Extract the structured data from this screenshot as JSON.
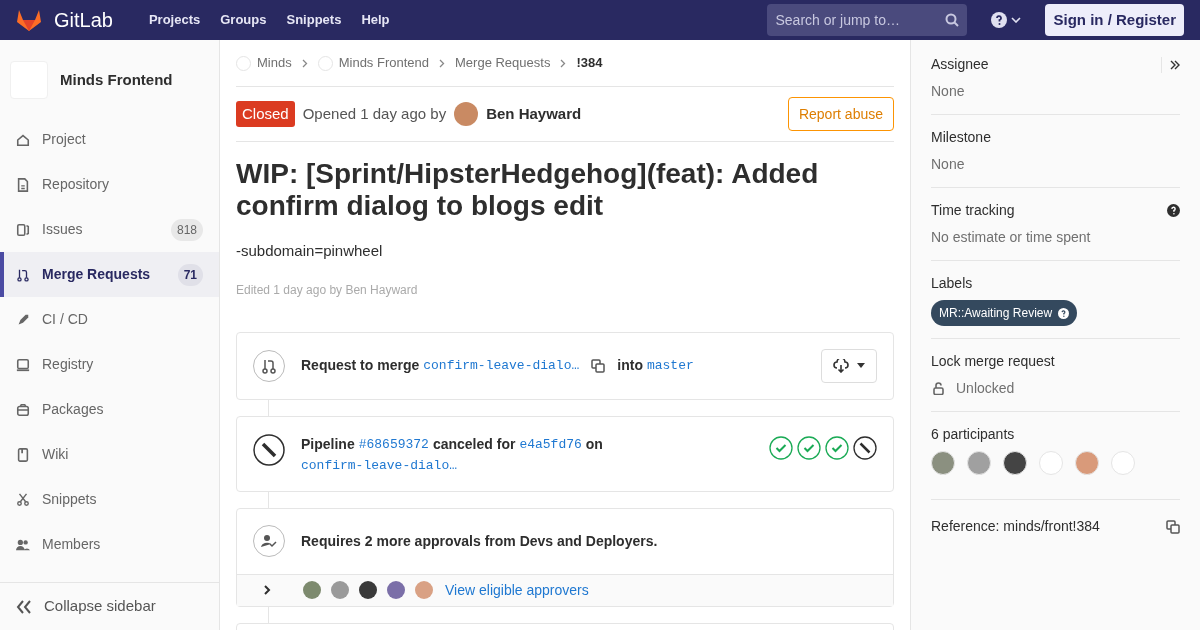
{
  "topbar": {
    "brand": "GitLab",
    "nav": [
      "Projects",
      "Groups",
      "Snippets",
      "Help"
    ],
    "search": {
      "placeholder": "Search or jump to…"
    },
    "sign_in": "Sign in / Register"
  },
  "sidebar": {
    "project": "Minds Frontend",
    "items": [
      {
        "label": "Project",
        "selected": false
      },
      {
        "label": "Repository",
        "selected": false
      },
      {
        "label": "Issues",
        "count": "818",
        "selected": false
      },
      {
        "label": "Merge Requests",
        "count": "71",
        "selected": true
      },
      {
        "label": "CI / CD",
        "selected": false
      },
      {
        "label": "Registry",
        "selected": false
      },
      {
        "label": "Packages",
        "selected": false
      },
      {
        "label": "Wiki",
        "selected": false
      },
      {
        "label": "Snippets",
        "selected": false
      },
      {
        "label": "Members",
        "selected": false
      }
    ],
    "collapse": "Collapse sidebar"
  },
  "breadcrumbs": [
    "Minds",
    "Minds Frontend",
    "Merge Requests",
    "!384"
  ],
  "header": {
    "status": "Closed",
    "opened": "Opened 1 day ago by",
    "author": "Ben Hayward",
    "report": "Report abuse"
  },
  "title": "WIP: [Sprint/HipsterHedgehog](feat): Added confirm dialog to blogs edit",
  "description": "-subdomain=pinwheel",
  "edited": "Edited 1 day ago by Ben Hayward",
  "merge": {
    "prefix": "Request to merge",
    "source": "confirm-leave-dialo…",
    "into": "into",
    "target": "master"
  },
  "pipeline": {
    "prefix": "Pipeline",
    "id": "#68659372",
    "status": "canceled for",
    "commit": "e4a5fd76",
    "on": "on",
    "branch": "confirm-leave-dialo…",
    "stages": [
      {
        "kind": "success"
      },
      {
        "kind": "success"
      },
      {
        "kind": "success"
      },
      {
        "kind": "canceled"
      }
    ]
  },
  "approvals": {
    "text": "Requires 2 more approvals from Devs and Deployers.",
    "link": "View eligible approvers"
  },
  "right_sidebar": {
    "sections": [
      {
        "kind": "text",
        "title": "Assignee",
        "value": "None"
      },
      {
        "kind": "text",
        "title": "Milestone",
        "value": "None"
      },
      {
        "kind": "help",
        "title": "Time tracking",
        "value": "No estimate or time spent"
      },
      {
        "kind": "label",
        "title": "Labels",
        "value": "MR::Awaiting Review"
      },
      {
        "kind": "lock",
        "title": "Lock merge request",
        "value": "Unlocked"
      },
      {
        "kind": "avatars",
        "title": "6 participants"
      },
      {
        "kind": "reference",
        "title": "Reference: minds/front!384"
      }
    ]
  }
}
